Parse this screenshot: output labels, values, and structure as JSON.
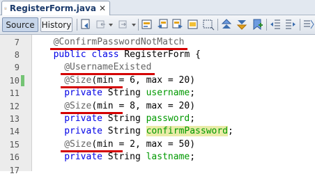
{
  "tab": {
    "title": "RegisterForm.java",
    "close": "✕",
    "icon": "java-file-icon"
  },
  "toolbar": {
    "source_label": "Source",
    "history_label": "History",
    "icons": [
      "last-edit-icon",
      "back-icon",
      "forward-icon",
      "find-selection-icon",
      "find-previous-icon",
      "find-next-icon",
      "toggle-highlight-icon",
      "rectangular-selection-icon",
      "previous-bookmark-icon",
      "next-bookmark-icon",
      "toggle-bookmark-icon",
      "shift-left-icon",
      "shift-right-icon"
    ]
  },
  "colors": {
    "annotation": "#646464",
    "keyword": "#0000e6",
    "field": "#009900",
    "highlight": "#e9eba7",
    "change_marker": "#74c474",
    "underline": "#d40000"
  },
  "lines": [
    {
      "n": "7",
      "indent": 1,
      "changed": false,
      "tokens": [
        {
          "t": "@ConfirmPasswordNotMatch",
          "c": "ann"
        }
      ]
    },
    {
      "n": "8",
      "indent": 1,
      "changed": false,
      "tokens": [
        {
          "t": "public",
          "c": "kw"
        },
        {
          "t": " "
        },
        {
          "t": "class",
          "c": "kw"
        },
        {
          "t": " RegisterForm {"
        }
      ]
    },
    {
      "n": "9",
      "indent": 2,
      "changed": false,
      "tokens": [
        {
          "t": "@UsernameExisted",
          "c": "ann"
        }
      ]
    },
    {
      "n": "10",
      "indent": 2,
      "changed": true,
      "tokens": [
        {
          "t": "@Size",
          "c": "ann"
        },
        {
          "t": "(min = 6, max = 20)"
        }
      ]
    },
    {
      "n": "11",
      "indent": 2,
      "changed": false,
      "tokens": [
        {
          "t": "private",
          "c": "kw"
        },
        {
          "t": " String "
        },
        {
          "t": "username",
          "c": "fld"
        },
        {
          "t": ";"
        }
      ]
    },
    {
      "n": "12",
      "indent": 2,
      "changed": false,
      "tokens": [
        {
          "t": "@Size",
          "c": "ann"
        },
        {
          "t": "(min = 8, max = 20)"
        }
      ]
    },
    {
      "n": "13",
      "indent": 2,
      "changed": false,
      "tokens": [
        {
          "t": "private",
          "c": "kw"
        },
        {
          "t": " String "
        },
        {
          "t": "password",
          "c": "fld"
        },
        {
          "t": ";"
        }
      ]
    },
    {
      "n": "14",
      "indent": 2,
      "changed": false,
      "tokens": [
        {
          "t": "private",
          "c": "kw"
        },
        {
          "t": " String "
        },
        {
          "t": "confirmPassword",
          "c": "fld hl"
        },
        {
          "t": ";"
        }
      ]
    },
    {
      "n": "15",
      "indent": 2,
      "changed": false,
      "tokens": [
        {
          "t": "@Size",
          "c": "ann"
        },
        {
          "t": "(min = 2, max = 50)"
        }
      ]
    },
    {
      "n": "16",
      "indent": 2,
      "changed": false,
      "tokens": [
        {
          "t": "private",
          "c": "kw"
        },
        {
          "t": " String "
        },
        {
          "t": "lastname",
          "c": "fld"
        },
        {
          "t": ";"
        }
      ]
    },
    {
      "n": "17",
      "indent": 0,
      "changed": false,
      "tokens": []
    }
  ]
}
